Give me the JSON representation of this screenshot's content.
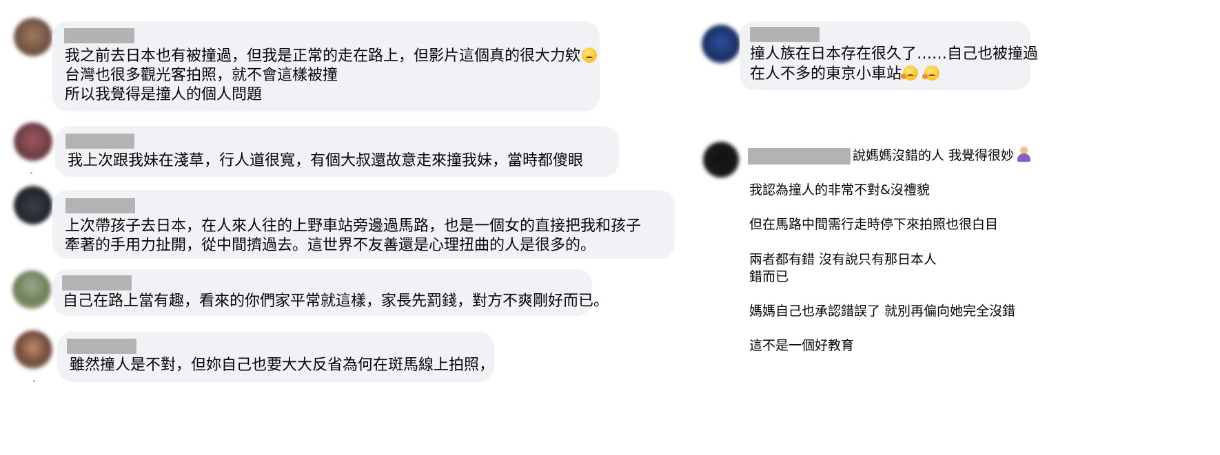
{
  "comments_left": [
    {
      "lines": [
        "我之前去日本也有被撞過，但我是正常的走在路上，但影片這個真的很大力欸",
        "台灣也很多觀光客拍照，就不會這樣被撞",
        "所以我覺得是撞人的個人問題"
      ],
      "emoji": "neutral-face"
    },
    {
      "lines": [
        "我上次跟我妹在淺草，行人道很寬，有個大叔還故意走來撞我妹，當時都傻眼"
      ]
    },
    {
      "lines": [
        "上次帶孩子去日本，在人來人往的上野車站旁邊過馬路，也是一個女的直接把我和孩子",
        "牽著的手用力扯開，從中間擠過去。這世界不友善還是心理扭曲的人是很多的。"
      ]
    },
    {
      "lines": [
        "自己在路上當有趣，看來的你們家平常就這樣，家長先罰錢，對方不爽剛好而已。"
      ]
    },
    {
      "lines": [
        "雖然撞人是不對，但妳自己也要大大反省為何在斑馬線上拍照，"
      ]
    }
  ],
  "comment_right_1": {
    "lines": [
      "撞人族在日本存在很久了……自己也被撞過",
      "在人不多的東京小車站"
    ],
    "emoji": "hugging-face"
  },
  "comment_right_2": {
    "header_text": "說媽媽沒錯的人 我覺得很妙",
    "emoji": "person-shrugging",
    "lines": [
      "我認為撞人的非常不對&沒禮貌",
      "但在馬路中間需行走時停下來拍照也很白目",
      "兩者都有錯 沒有說只有那日本人",
      "錯而已",
      "媽媽自己也承認錯誤了 就別再偏向她完全沒錯",
      "這不是一個好教育"
    ]
  },
  "colors": {
    "bubble": "#f0f2f5",
    "redaction": "#b3b3b3",
    "text": "#050505"
  }
}
